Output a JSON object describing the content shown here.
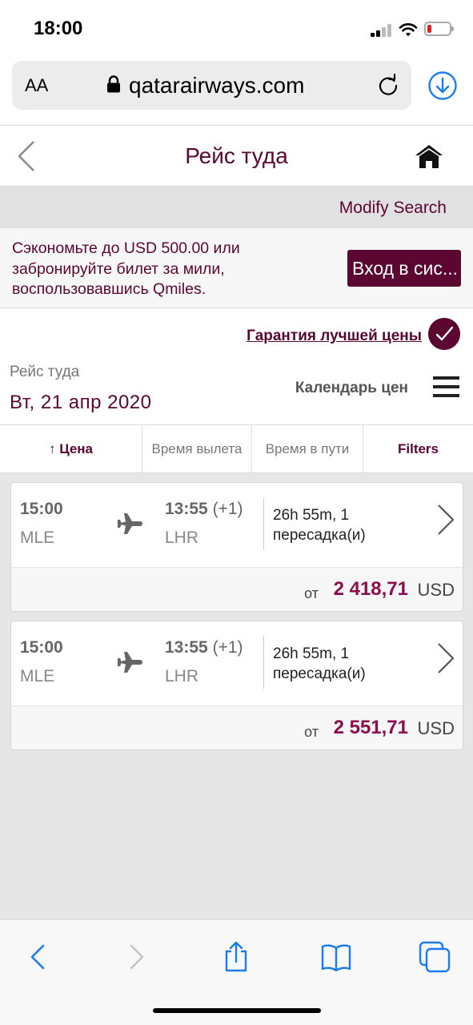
{
  "status": {
    "time": "18:00"
  },
  "browser": {
    "aa_label": "AA",
    "url": "qatarairways.com"
  },
  "header": {
    "title": "Рейс туда"
  },
  "modify_search": "Modify Search",
  "promo": {
    "text": "Сэкономьте до USD 500.00 или забронируйте билет за мили, воспользовавшись Qmiles.",
    "login_label": "Вход в сис..."
  },
  "guarantee": {
    "label": "Гарантия лучшей цены"
  },
  "date_block": {
    "label": "Рейс туда",
    "date": "Вт, 21 апр 2020",
    "calendar_label": "Календарь цен"
  },
  "sort": {
    "price_label": "↑ Цена",
    "departure_label": "Время вылета",
    "duration_label": "Время в пути",
    "filters_label": "Filters"
  },
  "flights": [
    {
      "dep_time": "15:00",
      "dep_code": "MLE",
      "arr_time": "13:55",
      "arr_offset": "(+1)",
      "arr_code": "LHR",
      "duration": "26h 55m, 1 пересадка(и)",
      "from_label": "от",
      "price": "2 418,71",
      "currency": "USD"
    },
    {
      "dep_time": "15:00",
      "dep_code": "MLE",
      "arr_time": "13:55",
      "arr_offset": "(+1)",
      "arr_code": "LHR",
      "duration": "26h 55m, 1 пересадка(и)",
      "from_label": "от",
      "price": "2 551,71",
      "currency": "USD"
    }
  ],
  "colors": {
    "brand": "#5c0632",
    "price": "#8c0f4c",
    "ios_blue": "#1a7cf0"
  },
  "icons": [
    "signal-icon",
    "wifi-icon",
    "battery-icon",
    "lock-icon",
    "reload-icon",
    "download-icon",
    "back-chevron-icon",
    "home-icon",
    "checkmark-icon",
    "hamburger-menu-icon",
    "plane-icon",
    "chevron-right-icon",
    "safari-back-icon",
    "safari-forward-icon",
    "share-icon",
    "bookmarks-icon",
    "tabs-icon"
  ]
}
